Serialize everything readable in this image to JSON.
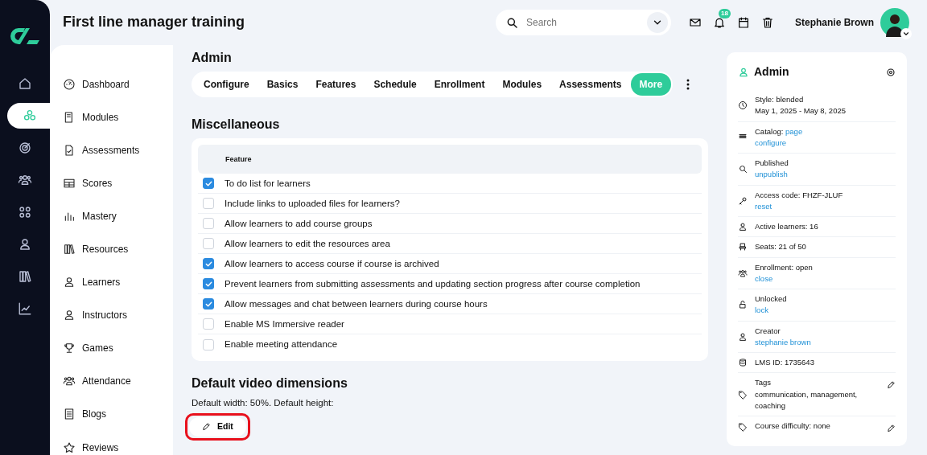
{
  "header": {
    "title": "First line manager training",
    "search": {
      "placeholder": "Search"
    },
    "notifications": {
      "count": "18"
    },
    "user": {
      "name": "Stephanie Brown"
    }
  },
  "rail": [
    {
      "selected": false
    },
    {
      "selected": true
    },
    {
      "selected": false
    },
    {
      "selected": false
    },
    {
      "selected": false
    },
    {
      "selected": false
    },
    {
      "selected": false
    },
    {
      "selected": false
    }
  ],
  "sidebar": {
    "items": [
      {
        "label": "Dashboard"
      },
      {
        "label": "Modules"
      },
      {
        "label": "Assessments"
      },
      {
        "label": "Scores"
      },
      {
        "label": "Mastery"
      },
      {
        "label": "Resources"
      },
      {
        "label": "Learners"
      },
      {
        "label": "Instructors"
      },
      {
        "label": "Games"
      },
      {
        "label": "Attendance"
      },
      {
        "label": "Blogs"
      },
      {
        "label": "Reviews"
      }
    ]
  },
  "admin": {
    "title": "Admin",
    "tabs": [
      {
        "label": "Configure",
        "selected": false
      },
      {
        "label": "Basics",
        "selected": false
      },
      {
        "label": "Features",
        "selected": false
      },
      {
        "label": "Schedule",
        "selected": false
      },
      {
        "label": "Enrollment",
        "selected": false
      },
      {
        "label": "Modules",
        "selected": false
      },
      {
        "label": "Assessments",
        "selected": false
      },
      {
        "label": "More",
        "selected": true
      }
    ]
  },
  "miscellaneous": {
    "title": "Miscellaneous",
    "column": "Feature",
    "rows": [
      {
        "label": "To do list for learners",
        "checked": true
      },
      {
        "label": "Include links to uploaded files for learners?",
        "checked": false
      },
      {
        "label": "Allow learners to add course groups",
        "checked": false
      },
      {
        "label": "Allow learners to edit the resources area",
        "checked": false
      },
      {
        "label": "Allow learners to access course if course is archived",
        "checked": true
      },
      {
        "label": "Prevent learners from submitting assessments and updating section progress after course completion",
        "checked": true
      },
      {
        "label": "Allow messages and chat between learners during course hours",
        "checked": true
      },
      {
        "label": "Enable MS Immersive reader",
        "checked": false
      },
      {
        "label": "Enable meeting attendance",
        "checked": false
      }
    ]
  },
  "video": {
    "title": "Default video dimensions",
    "text": "Default width: 50%. Default height:",
    "edit_button": {
      "label": "Edit",
      "highlighted": true
    }
  },
  "panel": {
    "title": "Admin",
    "rows": [
      {
        "label": "Style: blended",
        "detail": "May 1, 2025 - May 8, 2025"
      },
      {
        "label": "Catalog:",
        "inline_link": "page",
        "link": "configure"
      },
      {
        "label": "Published",
        "link": "unpublish"
      },
      {
        "label": "Access code: FHZF-JLUF",
        "link": "reset"
      },
      {
        "label": "Active learners: 16"
      },
      {
        "label": "Seats: 21 of 50"
      },
      {
        "label": "Enrollment: open",
        "link": "close"
      },
      {
        "label": "Unlocked",
        "link": "lock"
      },
      {
        "label": "Creator",
        "link": "stephanie brown"
      },
      {
        "label": "LMS ID: 1735643"
      },
      {
        "label": "Tags",
        "detail": "communication, management, coaching",
        "editable": true
      },
      {
        "label": "Course difficulty: none",
        "editable": true
      }
    ]
  }
}
